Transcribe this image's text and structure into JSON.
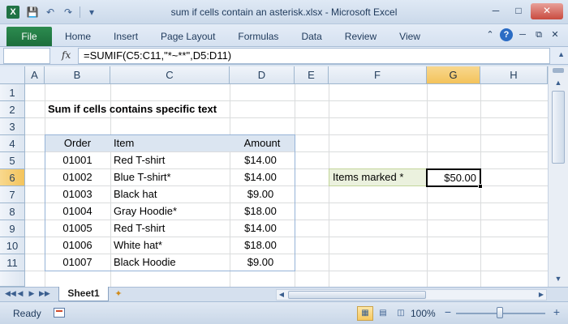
{
  "window": {
    "title": "sum if cells contain an asterisk.xlsx  -  Microsoft Excel",
    "app_icon": "X",
    "quick_access": [
      "save-icon",
      "undo-icon",
      "redo-icon",
      "customize-icon"
    ]
  },
  "ribbon": {
    "file_tab": "File",
    "tabs": [
      "Home",
      "Insert",
      "Page Layout",
      "Formulas",
      "Data",
      "Review",
      "View"
    ]
  },
  "formula_bar": {
    "name_box": "",
    "fx_label": "fx",
    "formula": "=SUMIF(C5:C11,\"*~**\",D5:D11)"
  },
  "grid": {
    "columns": [
      "A",
      "B",
      "C",
      "D",
      "E",
      "F",
      "G",
      "H"
    ],
    "rows": [
      "1",
      "2",
      "3",
      "4",
      "5",
      "6",
      "7",
      "8",
      "9",
      "10",
      "11"
    ],
    "selected_column": "G",
    "selected_row": "6",
    "title": "Sum if cells contains specific text",
    "table": {
      "headers": [
        "Order",
        "Item",
        "Amount"
      ],
      "rows": [
        [
          "01001",
          "Red T-shirt",
          "$14.00"
        ],
        [
          "01002",
          "Blue T-shirt*",
          "$14.00"
        ],
        [
          "01003",
          "Black hat",
          "$9.00"
        ],
        [
          "01004",
          "Gray Hoodie*",
          "$18.00"
        ],
        [
          "01005",
          "Red T-shirt",
          "$14.00"
        ],
        [
          "01006",
          "White hat*",
          "$18.00"
        ],
        [
          "01007",
          "Black Hoodie",
          "$9.00"
        ]
      ]
    },
    "result_label": "Items marked *",
    "result_value": "$50.00"
  },
  "sheets": {
    "tabs": [
      "Sheet1"
    ]
  },
  "status": {
    "text": "Ready",
    "zoom": "100%"
  },
  "colors": {
    "header_fill": "#dbe5f1",
    "label_fill": "#ebf1de",
    "selected_header": "#f3c35b",
    "excel_green": "#1f7244"
  }
}
